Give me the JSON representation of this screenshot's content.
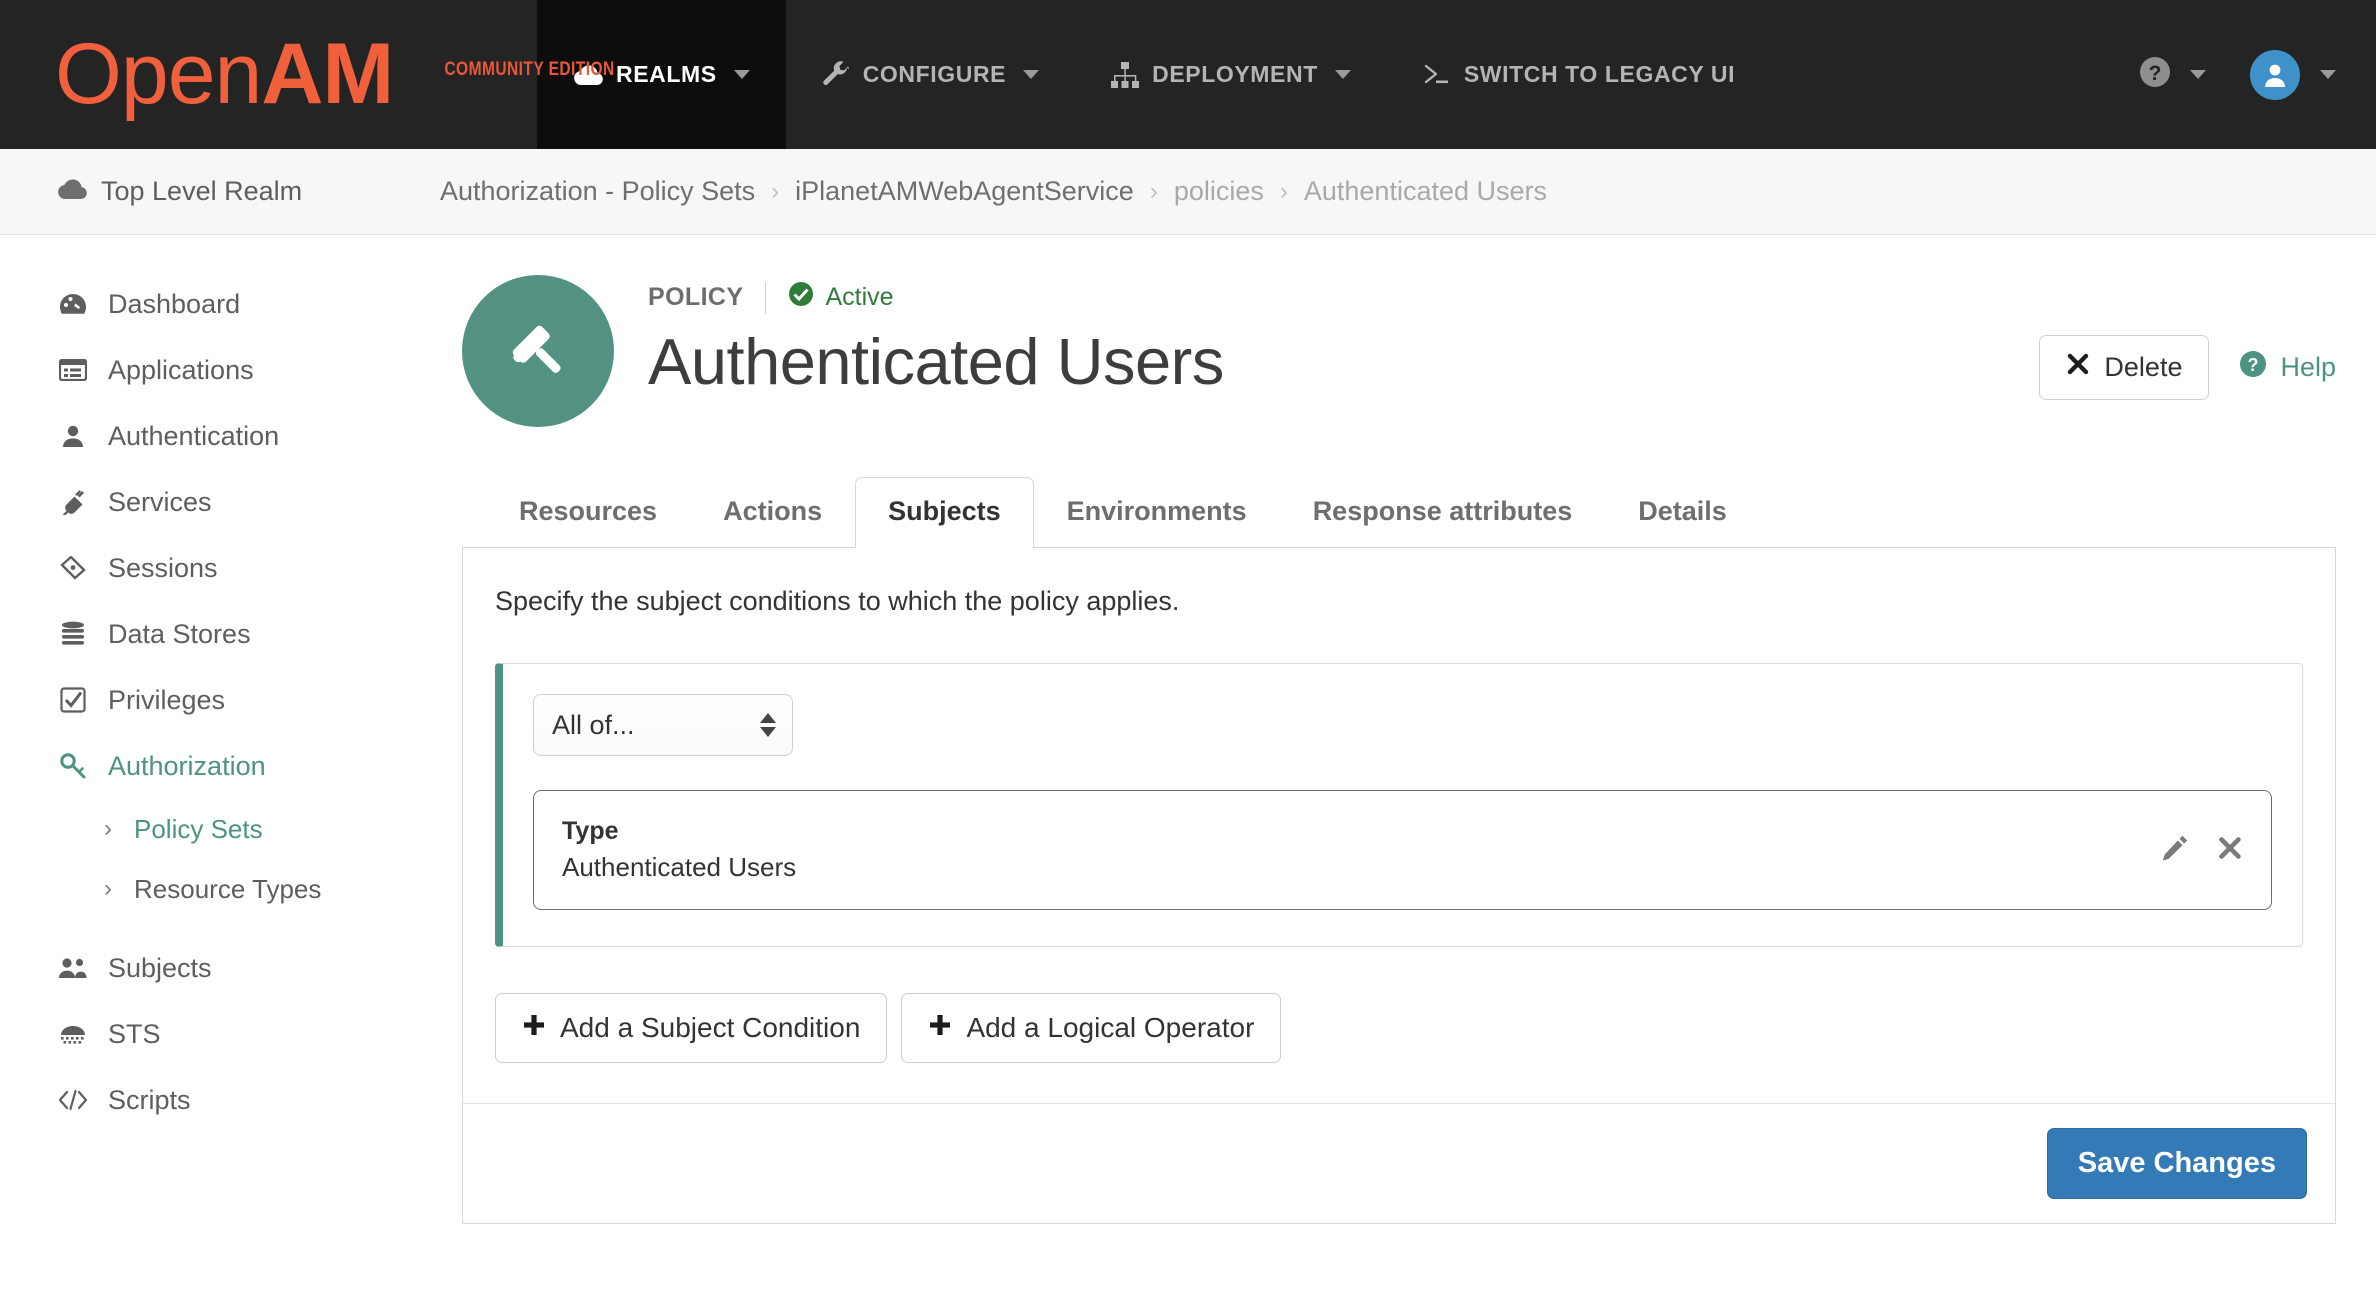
{
  "brand": {
    "name_light": "Open",
    "name_bold": "AM",
    "edition": "COMMUNITY EDITION"
  },
  "navbar": {
    "items": [
      {
        "label": "REALMS",
        "icon": "cloud-icon",
        "active": true,
        "has_caret": true
      },
      {
        "label": "CONFIGURE",
        "icon": "wrench-icon",
        "active": false,
        "has_caret": true
      },
      {
        "label": "DEPLOYMENT",
        "icon": "sitemap-icon",
        "active": false,
        "has_caret": true
      },
      {
        "label": "SWITCH TO LEGACY UI",
        "icon": "terminal-icon",
        "active": false,
        "has_caret": false
      }
    ],
    "help_icon": "question-circle-icon",
    "user_icon": "user-avatar-icon",
    "avatar_color": "#3f91c9"
  },
  "breadcrumb": {
    "realm": "Top Level Realm",
    "realm_icon": "cloud-icon",
    "separator": "›",
    "items": [
      {
        "label": "Authorization - Policy Sets",
        "muted": false
      },
      {
        "label": "iPlanetAMWebAgentService",
        "muted": false
      },
      {
        "label": "policies",
        "muted": true
      },
      {
        "label": "Authenticated Users",
        "muted": true
      }
    ]
  },
  "sidebar": {
    "items": [
      {
        "label": "Dashboard",
        "icon": "dashboard-icon",
        "active": false
      },
      {
        "label": "Applications",
        "icon": "applications-icon",
        "active": false
      },
      {
        "label": "Authentication",
        "icon": "user-icon",
        "active": false
      },
      {
        "label": "Services",
        "icon": "plug-icon",
        "active": false
      },
      {
        "label": "Sessions",
        "icon": "ticket-icon",
        "active": false
      },
      {
        "label": "Data Stores",
        "icon": "database-icon",
        "active": false
      },
      {
        "label": "Privileges",
        "icon": "check-square-icon",
        "active": false
      },
      {
        "label": "Authorization",
        "icon": "key-icon",
        "active": true
      },
      {
        "label": "Subjects",
        "icon": "users-icon",
        "active": false
      },
      {
        "label": "STS",
        "icon": "sts-icon",
        "active": false
      },
      {
        "label": "Scripts",
        "icon": "code-icon",
        "active": false
      }
    ],
    "sub_items": [
      {
        "label": "Policy Sets",
        "active": true,
        "chevron": "›"
      },
      {
        "label": "Resource Types",
        "active": false,
        "chevron": "›"
      }
    ]
  },
  "policy": {
    "icon": "gavel-icon",
    "icon_bg": "#539183",
    "kind": "POLICY",
    "status": "Active",
    "status_icon": "check-circle-icon",
    "status_color": "#2f7d3b",
    "title": "Authenticated Users",
    "delete_label": "Delete",
    "delete_icon": "close-icon",
    "help_label": "Help",
    "help_icon": "question-circle-icon",
    "help_color": "#4e9283"
  },
  "tabs": [
    {
      "label": "Resources",
      "active": false
    },
    {
      "label": "Actions",
      "active": false
    },
    {
      "label": "Subjects",
      "active": true
    },
    {
      "label": "Environments",
      "active": false
    },
    {
      "label": "Response attributes",
      "active": false
    },
    {
      "label": "Details",
      "active": false
    }
  ],
  "subjects_panel": {
    "description": "Specify the subject conditions to which the policy applies.",
    "accent_color": "#4e9283",
    "operator_select": {
      "value": "All of...",
      "icon": "stepper-icon"
    },
    "condition": {
      "label": "Type",
      "value": "Authenticated Users",
      "edit_icon": "pencil-icon",
      "remove_icon": "close-icon"
    },
    "add_condition_label": "Add a Subject Condition",
    "add_operator_label": "Add a Logical Operator",
    "plus_icon": "plus-icon",
    "save_label": "Save Changes",
    "save_color": "#337ab7"
  }
}
